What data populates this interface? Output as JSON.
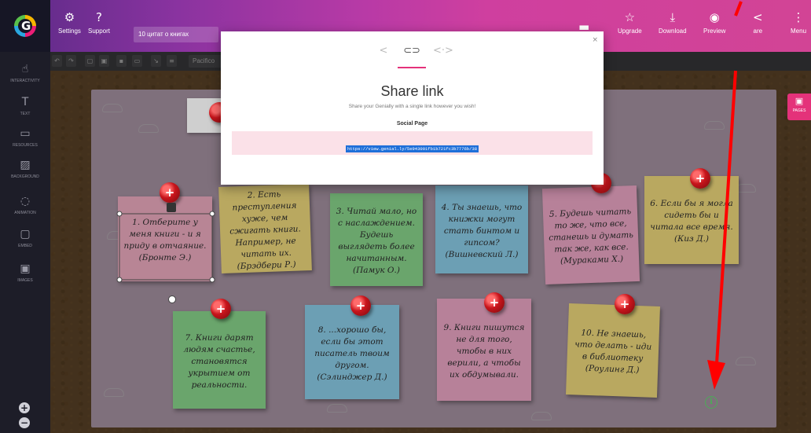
{
  "topbar": {
    "settings_label": "Settings",
    "support_label": "Support",
    "title_value": "10 цитат о книгах",
    "upgrade_label": "Upgrade",
    "download_label": "Download",
    "preview_label": "Preview",
    "share_label": "are",
    "menu_label": "Menu"
  },
  "toolbar": {
    "font_value": "Pacifico"
  },
  "sidebar": {
    "items": [
      {
        "label": "INTERACTIVITY",
        "icon": "hand-icon"
      },
      {
        "label": "TEXT",
        "icon": "text-icon"
      },
      {
        "label": "RESOURCES",
        "icon": "resources-icon"
      },
      {
        "label": "BACKGROUND",
        "icon": "background-icon"
      },
      {
        "label": "ANIMATION",
        "icon": "animation-icon"
      },
      {
        "label": "EMBED",
        "icon": "embed-icon"
      },
      {
        "label": "IMAGES",
        "icon": "images-icon"
      }
    ],
    "zoom_in": "+",
    "zoom_out": "−"
  },
  "pages_button": "PAGES",
  "notes": [
    {
      "text": "1. Отберите у меня книги - и я приду в отчаяние. (Бронте Э.)",
      "color": "#f3a6b8"
    },
    {
      "text": "2. Есть преступления хуже, чем сжигать книги. Например, не читать их. (Брэдбери Р.)",
      "color": "#f6e27a"
    },
    {
      "text": "3. Читай мало, но с наслаждением. Будешь выглядеть более начитанным. (Памук О.)",
      "color": "#8fdc8f"
    },
    {
      "text": "4. Ты знаешь, что книжки могут стать бинтом и гипсом? (Вишневский Л.)",
      "color": "#8fd3f0"
    },
    {
      "text": "5. Будешь читать то же, что все, станешь и думать так же, как все. (Мураками Х.)",
      "color": "#f4a6c4"
    },
    {
      "text": "6. Если бы я могла сидеть бы и читала все время. (Киз Д.)",
      "color": "#f6e27a"
    },
    {
      "text": "7. Книги дарят людям счастье, становятся укрытием от реальности.",
      "color": "#8fdc8f"
    },
    {
      "text": "8. ...хорошо бы, если бы этот писатель твоим другом. (Сэлинджер Д.)",
      "color": "#8fd3f0"
    },
    {
      "text": "9. Книги пишутся не для того, чтобы в них верили, а чтобы их обдумывали.",
      "color": "#f4a6c4"
    },
    {
      "text": "10. Не знаешь, что делать - иди в библиотеку (Роулинг Д.)",
      "color": "#f6e27a"
    }
  ],
  "modal": {
    "title": "Share link",
    "subtitle": "Share your Genially with a single link however you wish!",
    "social_label": "Social Page",
    "link": "https://view.genial.ly/5e943001fb1b721fc3b7776b/38",
    "close": "×"
  },
  "colors": {
    "accent": "#e4327a",
    "arrow": "#ff0000",
    "info": "#4cab58"
  }
}
